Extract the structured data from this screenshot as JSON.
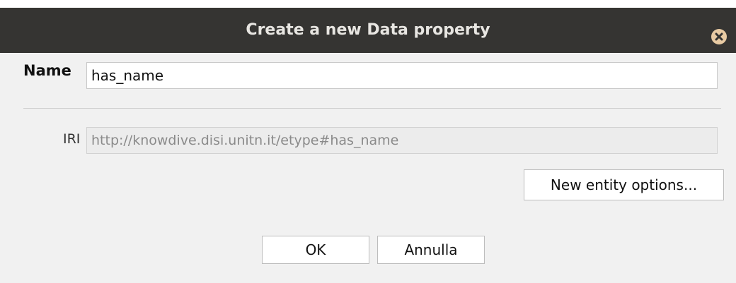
{
  "dialog": {
    "title": "Create a new Data property",
    "close_icon": "close-icon"
  },
  "form": {
    "name_label": "Name",
    "name_value": "has_name",
    "iri_label": "IRI",
    "iri_value": "http://knowdive.disi.unitn.it/etype#has_name"
  },
  "buttons": {
    "options_label": "New entity options...",
    "ok_label": "OK",
    "cancel_label": "Annulla"
  },
  "colors": {
    "titlebar": "#353432",
    "close_button": "#e8caa3",
    "background": "#f1f1f1"
  }
}
